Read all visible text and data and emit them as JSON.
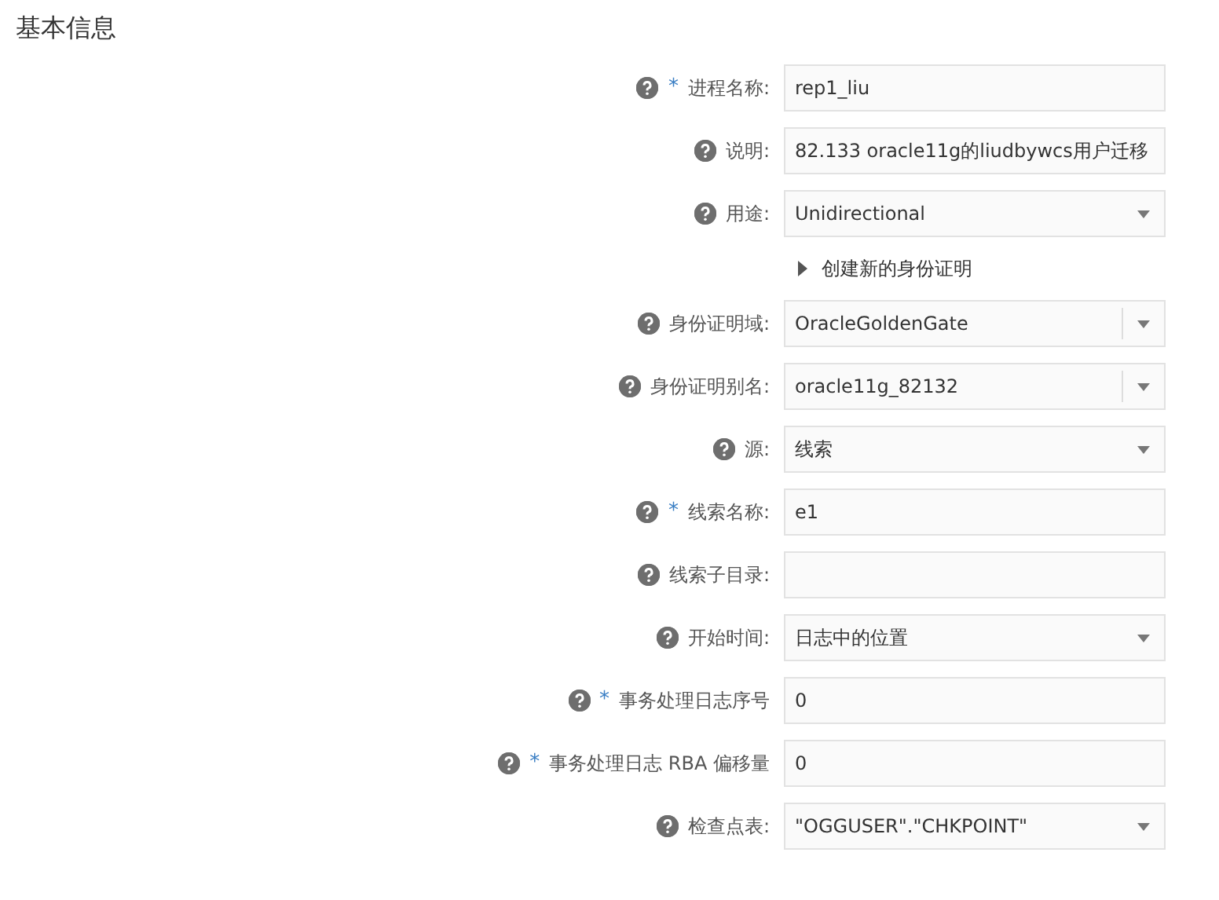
{
  "section_title": "基本信息",
  "rows": [
    {
      "kind": "text",
      "label": "进程名称:",
      "marker": "*",
      "value": "rep1_liu"
    },
    {
      "kind": "text",
      "label": "说明:",
      "value": "82.133 oracle11g的liudbywcs用户迁移"
    },
    {
      "kind": "select",
      "label": "用途:",
      "value": "Unidirectional"
    },
    {
      "kind": "toggle",
      "label": "创建新的身份证明",
      "expanded": false
    },
    {
      "kind": "combo",
      "label": "身份证明域:",
      "value": "OracleGoldenGate"
    },
    {
      "kind": "combo",
      "label": "身份证明别名:",
      "value": "oracle11g_82132"
    },
    {
      "kind": "select",
      "label": "源:",
      "value": "线索"
    },
    {
      "kind": "text",
      "label": "线索名称:",
      "marker": "*",
      "value": "e1"
    },
    {
      "kind": "text",
      "label": "线索子目录:",
      "value": ""
    },
    {
      "kind": "select",
      "label": "开始时间:",
      "value": "日志中的位置"
    },
    {
      "kind": "text",
      "label": "事务处理日志序号",
      "marker": "*",
      "value": "0"
    },
    {
      "kind": "text",
      "label": "事务处理日志 RBA 偏移量",
      "marker": "*",
      "value": "0"
    },
    {
      "kind": "select",
      "label": "检查点表:",
      "value": "\"OGGUSER\".\"CHKPOINT\""
    }
  ]
}
